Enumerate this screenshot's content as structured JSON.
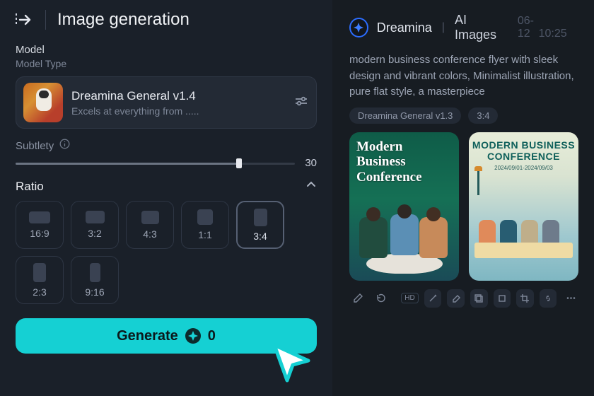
{
  "header": {
    "title": "Image generation"
  },
  "model": {
    "section_label": "Model",
    "type_label": "Model Type",
    "name": "Dreamina General v1.4",
    "description": "Excels at everything from ....."
  },
  "subtlety": {
    "label": "Subtlety",
    "value": "30"
  },
  "ratio": {
    "label": "Ratio",
    "options": [
      "16:9",
      "3:2",
      "4:3",
      "1:1",
      "3:4",
      "2:3",
      "9:16"
    ],
    "selected": "3:4"
  },
  "generate": {
    "label": "Generate",
    "credits": "0"
  },
  "result": {
    "app_name": "Dreamina",
    "section": "AI Images",
    "date": "06-12",
    "time": "10:25",
    "prompt": "modern business conference flyer with sleek design and vibrant colors, Minimalist illustration, pure flat style, a masterpiece",
    "chips": [
      "Dreamina General v1.3",
      "3:4"
    ],
    "thumbs": {
      "t1_title": "Modern Business Conference",
      "t2_title": "MODERN BUSINESS CONFERENCE",
      "t2_date": "2024/09/01-2024/09/03"
    },
    "hd_label": "HD"
  }
}
